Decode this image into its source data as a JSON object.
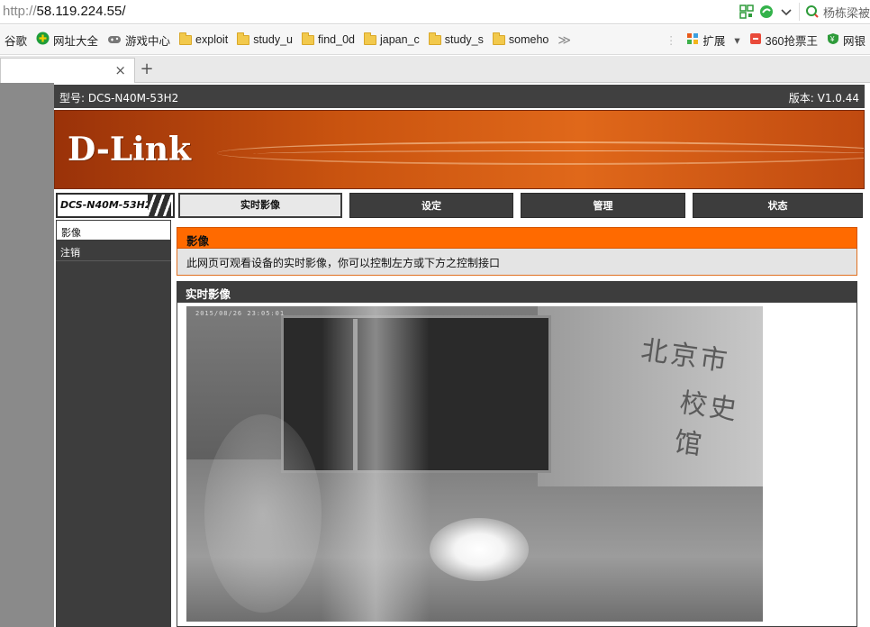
{
  "browser": {
    "url_proto": "http://",
    "url_host": "58.119.224.55/",
    "search_text": "杨栋梁被",
    "tab_close": "×",
    "new_tab": "+"
  },
  "bookmarks": {
    "items": [
      {
        "label": "谷歌",
        "icon": "none"
      },
      {
        "label": "网址大全",
        "icon": "plus-circle-icon"
      },
      {
        "label": "游戏中心",
        "icon": "gamepad-icon"
      },
      {
        "label": "exploit",
        "icon": "folder-icon"
      },
      {
        "label": "study_u",
        "icon": "folder-icon"
      },
      {
        "label": "find_0d",
        "icon": "folder-icon"
      },
      {
        "label": "japan_c",
        "icon": "folder-icon"
      },
      {
        "label": "study_s",
        "icon": "folder-icon"
      },
      {
        "label": "someho",
        "icon": "folder-icon"
      }
    ],
    "more": "≫",
    "extensions": "扩展",
    "ext_arrow": "▾",
    "qiangpiao": "360抢票王",
    "wangyin": "网银"
  },
  "camera": {
    "model_line": "型号: DCS-N40M-53H2",
    "version_line": "版本: V1.0.44",
    "brand_logo": "D-Link",
    "model_badge": "DCS-N40M-53H2",
    "nav_tabs": [
      "实时影像",
      "设定",
      "管理",
      "状态"
    ],
    "sidebar": [
      "影像",
      "注销"
    ],
    "section_title": "影像",
    "section_desc": "此网页可观看设备的实时影像，你可以控制左方或下方之控制接口",
    "live_title": "实时影像",
    "video_timestamp": "2015/08/26 23:05:01",
    "wall_text_line1": "北京市",
    "wall_text_line2": "校史馆"
  },
  "colors": {
    "orange": "#ff6a00",
    "dark": "#3d3d3d"
  }
}
